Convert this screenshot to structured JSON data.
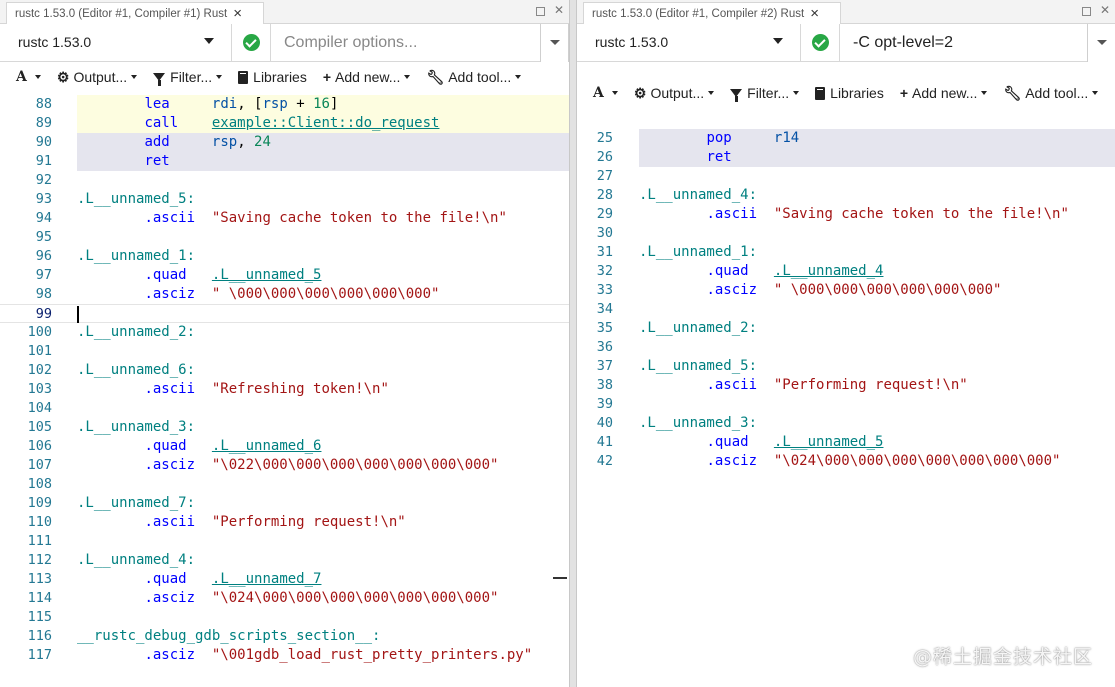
{
  "left": {
    "tab_title": "rustc 1.53.0 (Editor #1, Compiler #1) Rust",
    "compiler": "rustc 1.53.0",
    "options_value": "",
    "options_placeholder": "Compiler options...",
    "toolbar": {
      "output": "Output...",
      "filter": "Filter...",
      "libraries": "Libraries",
      "add_new": "Add new...",
      "add_tool": "Add tool..."
    },
    "lines": [
      {
        "n": "88",
        "hl": "yellow",
        "tokens": [
          [
            "        ",
            ""
          ],
          [
            "lea",
            "ins"
          ],
          [
            "     ",
            ""
          ],
          [
            "rdi",
            "reg"
          ],
          [
            ", [",
            "pun"
          ],
          [
            "rsp",
            "reg"
          ],
          [
            " + ",
            "pun"
          ],
          [
            "16",
            "num"
          ],
          [
            "]",
            "pun"
          ]
        ]
      },
      {
        "n": "89",
        "hl": "yellow",
        "tokens": [
          [
            "        ",
            ""
          ],
          [
            "call",
            "ins"
          ],
          [
            "    ",
            ""
          ],
          [
            "example::Client::do_request",
            "ref"
          ]
        ]
      },
      {
        "n": "90",
        "hl": "blue",
        "tokens": [
          [
            "        ",
            ""
          ],
          [
            "add",
            "ins"
          ],
          [
            "     ",
            ""
          ],
          [
            "rsp",
            "reg"
          ],
          [
            ", ",
            "pun"
          ],
          [
            "24",
            "num"
          ]
        ]
      },
      {
        "n": "91",
        "hl": "blue",
        "tokens": [
          [
            "        ",
            ""
          ],
          [
            "ret",
            "ins"
          ]
        ]
      },
      {
        "n": "92",
        "hl": "",
        "tokens": []
      },
      {
        "n": "93",
        "hl": "",
        "tokens": [
          [
            ".L__unnamed_5:",
            "lbl"
          ]
        ]
      },
      {
        "n": "94",
        "hl": "",
        "tokens": [
          [
            "        ",
            ""
          ],
          [
            ".ascii",
            "ins"
          ],
          [
            "  ",
            ""
          ],
          [
            "\"Saving cache token to the file!\\n\"",
            "str"
          ]
        ]
      },
      {
        "n": "95",
        "hl": "",
        "tokens": []
      },
      {
        "n": "96",
        "hl": "",
        "tokens": [
          [
            ".L__unnamed_1:",
            "lbl"
          ]
        ]
      },
      {
        "n": "97",
        "hl": "",
        "tokens": [
          [
            "        ",
            ""
          ],
          [
            ".quad",
            "ins"
          ],
          [
            "   ",
            ""
          ],
          [
            ".L__unnamed_5",
            "ref"
          ]
        ]
      },
      {
        "n": "98",
        "hl": "",
        "tokens": [
          [
            "        ",
            ""
          ],
          [
            ".asciz",
            "ins"
          ],
          [
            "  ",
            ""
          ],
          [
            "\" \\000\\000\\000\\000\\000\\000\"",
            "str"
          ]
        ]
      },
      {
        "n": "99",
        "hl": "current",
        "tokens": []
      },
      {
        "n": "100",
        "hl": "",
        "tokens": [
          [
            ".L__unnamed_2:",
            "lbl"
          ]
        ]
      },
      {
        "n": "101",
        "hl": "",
        "tokens": []
      },
      {
        "n": "102",
        "hl": "",
        "tokens": [
          [
            ".L__unnamed_6:",
            "lbl"
          ]
        ]
      },
      {
        "n": "103",
        "hl": "",
        "tokens": [
          [
            "        ",
            ""
          ],
          [
            ".ascii",
            "ins"
          ],
          [
            "  ",
            ""
          ],
          [
            "\"Refreshing token!\\n\"",
            "str"
          ]
        ]
      },
      {
        "n": "104",
        "hl": "",
        "tokens": []
      },
      {
        "n": "105",
        "hl": "",
        "tokens": [
          [
            ".L__unnamed_3:",
            "lbl"
          ]
        ]
      },
      {
        "n": "106",
        "hl": "",
        "tokens": [
          [
            "        ",
            ""
          ],
          [
            ".quad",
            "ins"
          ],
          [
            "   ",
            ""
          ],
          [
            ".L__unnamed_6",
            "ref"
          ]
        ]
      },
      {
        "n": "107",
        "hl": "",
        "tokens": [
          [
            "        ",
            ""
          ],
          [
            ".asciz",
            "ins"
          ],
          [
            "  ",
            ""
          ],
          [
            "\"\\022\\000\\000\\000\\000\\000\\000\\000\"",
            "str"
          ]
        ]
      },
      {
        "n": "108",
        "hl": "",
        "tokens": []
      },
      {
        "n": "109",
        "hl": "",
        "tokens": [
          [
            ".L__unnamed_7:",
            "lbl"
          ]
        ]
      },
      {
        "n": "110",
        "hl": "",
        "tokens": [
          [
            "        ",
            ""
          ],
          [
            ".ascii",
            "ins"
          ],
          [
            "  ",
            ""
          ],
          [
            "\"Performing request!\\n\"",
            "str"
          ]
        ]
      },
      {
        "n": "111",
        "hl": "",
        "tokens": []
      },
      {
        "n": "112",
        "hl": "",
        "tokens": [
          [
            ".L__unnamed_4:",
            "lbl"
          ]
        ]
      },
      {
        "n": "113",
        "hl": "",
        "tokens": [
          [
            "        ",
            ""
          ],
          [
            ".quad",
            "ins"
          ],
          [
            "   ",
            ""
          ],
          [
            ".L__unnamed_7",
            "ref"
          ]
        ]
      },
      {
        "n": "114",
        "hl": "",
        "tokens": [
          [
            "        ",
            ""
          ],
          [
            ".asciz",
            "ins"
          ],
          [
            "  ",
            ""
          ],
          [
            "\"\\024\\000\\000\\000\\000\\000\\000\\000\"",
            "str"
          ]
        ]
      },
      {
        "n": "115",
        "hl": "",
        "tokens": []
      },
      {
        "n": "116",
        "hl": "",
        "tokens": [
          [
            "__rustc_debug_gdb_scripts_section__:",
            "lbl"
          ]
        ]
      },
      {
        "n": "117",
        "hl": "",
        "tokens": [
          [
            "        ",
            ""
          ],
          [
            ".asciz",
            "ins"
          ],
          [
            "  ",
            ""
          ],
          [
            "\"\\001gdb_load_rust_pretty_printers.py\"",
            "str"
          ]
        ]
      }
    ]
  },
  "right": {
    "tab_title": "rustc 1.53.0 (Editor #1, Compiler #2) Rust",
    "compiler": "rustc 1.53.0",
    "options_value": "-C opt-level=2",
    "options_placeholder": "Compiler options...",
    "toolbar": {
      "output": "Output...",
      "filter": "Filter...",
      "libraries": "Libraries",
      "add_new": "Add new...",
      "add_tool": "Add tool..."
    },
    "lines": [
      {
        "n": "25",
        "hl": "blue",
        "tokens": [
          [
            "        ",
            ""
          ],
          [
            "pop",
            "ins"
          ],
          [
            "     ",
            ""
          ],
          [
            "r14",
            "reg"
          ]
        ]
      },
      {
        "n": "26",
        "hl": "blue",
        "tokens": [
          [
            "        ",
            ""
          ],
          [
            "ret",
            "ins"
          ]
        ]
      },
      {
        "n": "27",
        "hl": "",
        "tokens": []
      },
      {
        "n": "28",
        "hl": "",
        "tokens": [
          [
            ".L__unnamed_4:",
            "lbl"
          ]
        ]
      },
      {
        "n": "29",
        "hl": "",
        "tokens": [
          [
            "        ",
            ""
          ],
          [
            ".ascii",
            "ins"
          ],
          [
            "  ",
            ""
          ],
          [
            "\"Saving cache token to the file!\\n\"",
            "str"
          ]
        ]
      },
      {
        "n": "30",
        "hl": "",
        "tokens": []
      },
      {
        "n": "31",
        "hl": "",
        "tokens": [
          [
            ".L__unnamed_1:",
            "lbl"
          ]
        ]
      },
      {
        "n": "32",
        "hl": "",
        "tokens": [
          [
            "        ",
            ""
          ],
          [
            ".quad",
            "ins"
          ],
          [
            "   ",
            ""
          ],
          [
            ".L__unnamed_4",
            "ref"
          ]
        ]
      },
      {
        "n": "33",
        "hl": "",
        "tokens": [
          [
            "        ",
            ""
          ],
          [
            ".asciz",
            "ins"
          ],
          [
            "  ",
            ""
          ],
          [
            "\" \\000\\000\\000\\000\\000\\000\"",
            "str"
          ]
        ]
      },
      {
        "n": "34",
        "hl": "",
        "tokens": []
      },
      {
        "n": "35",
        "hl": "",
        "tokens": [
          [
            ".L__unnamed_2:",
            "lbl"
          ]
        ]
      },
      {
        "n": "36",
        "hl": "",
        "tokens": []
      },
      {
        "n": "37",
        "hl": "",
        "tokens": [
          [
            ".L__unnamed_5:",
            "lbl"
          ]
        ]
      },
      {
        "n": "38",
        "hl": "",
        "tokens": [
          [
            "        ",
            ""
          ],
          [
            ".ascii",
            "ins"
          ],
          [
            "  ",
            ""
          ],
          [
            "\"Performing request!\\n\"",
            "str"
          ]
        ]
      },
      {
        "n": "39",
        "hl": "",
        "tokens": []
      },
      {
        "n": "40",
        "hl": "",
        "tokens": [
          [
            ".L__unnamed_3:",
            "lbl"
          ]
        ]
      },
      {
        "n": "41",
        "hl": "",
        "tokens": [
          [
            "        ",
            ""
          ],
          [
            ".quad",
            "ins"
          ],
          [
            "   ",
            ""
          ],
          [
            ".L__unnamed_5",
            "ref"
          ]
        ]
      },
      {
        "n": "42",
        "hl": "",
        "tokens": [
          [
            "        ",
            ""
          ],
          [
            ".asciz",
            "ins"
          ],
          [
            "  ",
            ""
          ],
          [
            "\"\\024\\000\\000\\000\\000\\000\\000\\000\"",
            "str"
          ]
        ]
      }
    ]
  },
  "watermark": "@稀土掘金技术社区",
  "icons": {
    "close": "close-icon",
    "minimize": "minimize-icon",
    "maximize": "maximize-icon",
    "status": "check-circle-icon",
    "font": "font-size-icon",
    "output": "gear-icon",
    "filter": "filter-icon",
    "libraries": "book-icon",
    "add_new": "plus-icon",
    "add_tool": "wrench-icon"
  },
  "colors": {
    "status_ok": "#28a745",
    "current_exec_highlight": "#fdfde0",
    "return_highlight": "#e5e5ee",
    "line_number": "#237893"
  }
}
